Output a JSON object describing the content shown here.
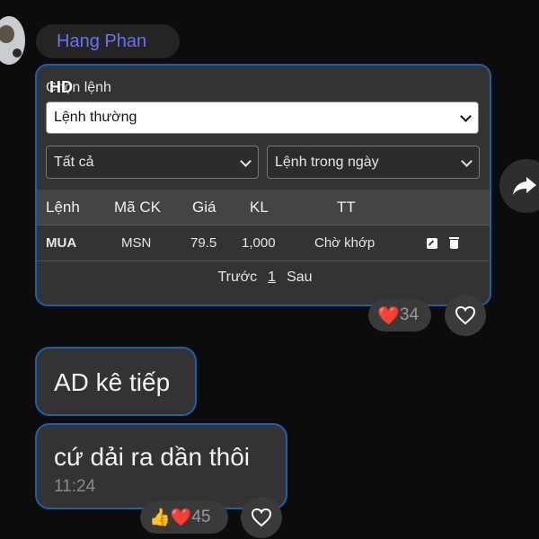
{
  "sender": {
    "name": "Hang Phan"
  },
  "order_panel": {
    "hd_label": "HD",
    "title": "Chọn lệnh",
    "order_type_select": {
      "value": "Lệnh thường"
    },
    "filter_select": {
      "value": "Tất cả"
    },
    "period_select": {
      "value": "Lệnh trong ngày"
    },
    "table": {
      "headers": [
        "Lệnh",
        "Mã CK",
        "Giá",
        "KL",
        "TT"
      ],
      "rows": [
        {
          "side": "MUA",
          "symbol": "MSN",
          "price": "79.5",
          "volume": "1,000",
          "status": "Chờ khớp"
        }
      ]
    },
    "pagination": {
      "prev": "Trước",
      "page": "1",
      "next": "Sau"
    }
  },
  "reactions_1": {
    "emoji": "❤️",
    "count": "34"
  },
  "messages": [
    {
      "text": "AD kê tiếp"
    },
    {
      "text": "cứ dải ra dần thôi",
      "time": "11:24"
    }
  ],
  "reactions_2": {
    "emoji": "👍❤️",
    "count": "45"
  },
  "icons": {
    "share": "share-arrow-icon",
    "react": "heart-outline-icon",
    "edit": "edit-icon",
    "delete": "trash-icon"
  },
  "colors": {
    "accent_border": "#1f5fa8",
    "sender_name": "#6f6ff5",
    "buy": "#2fae4c"
  }
}
